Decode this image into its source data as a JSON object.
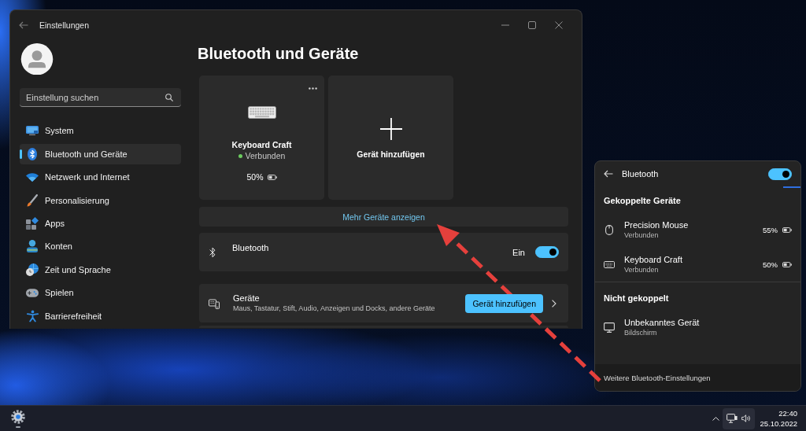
{
  "settings_window": {
    "title": "Einstellungen"
  },
  "sidebar": {
    "search": {
      "placeholder": "Einstellung suchen"
    },
    "items": [
      {
        "label": "System",
        "selected": false
      },
      {
        "label": "Bluetooth und Geräte",
        "selected": true
      },
      {
        "label": "Netzwerk und Internet",
        "selected": false
      },
      {
        "label": "Personalisierung",
        "selected": false
      },
      {
        "label": "Apps",
        "selected": false
      },
      {
        "label": "Konten",
        "selected": false
      },
      {
        "label": "Zeit und Sprache",
        "selected": false
      },
      {
        "label": "Spielen",
        "selected": false
      },
      {
        "label": "Barrierefreiheit",
        "selected": false
      }
    ]
  },
  "main": {
    "title": "Bluetooth und Geräte",
    "device_cards": [
      {
        "kind": "device",
        "name": "Keyboard Craft",
        "status": "Verbunden",
        "connected": true,
        "battery": "50%"
      },
      {
        "kind": "add",
        "label": "Gerät hinzufügen"
      }
    ],
    "more_devices": "Mehr Geräte anzeigen",
    "bluetooth_row": {
      "label": "Bluetooth",
      "state_label": "Ein",
      "on": true
    },
    "devices_row": {
      "title": "Geräte",
      "subtitle": "Maus, Tastatur, Stift, Audio, Anzeigen und Docks, andere Geräte",
      "button": "Gerät hinzufügen"
    }
  },
  "bluetooth_flyout": {
    "title": "Bluetooth",
    "on": true,
    "sections": [
      {
        "heading": "Gekoppelte Geräte",
        "devices": [
          {
            "name": "Precision Mouse",
            "status": "Verbunden",
            "battery": "55%"
          },
          {
            "name": "Keyboard Craft",
            "status": "Verbunden",
            "battery": "50%"
          }
        ]
      },
      {
        "heading": "Nicht gekoppelt",
        "devices": [
          {
            "name": "Unbekanntes Gerät",
            "status": "Bildschirm"
          }
        ]
      }
    ],
    "footer_link": "Weitere Bluetooth-Einstellungen"
  },
  "taskbar": {
    "time": "22:40",
    "date": "25.10.2022"
  }
}
